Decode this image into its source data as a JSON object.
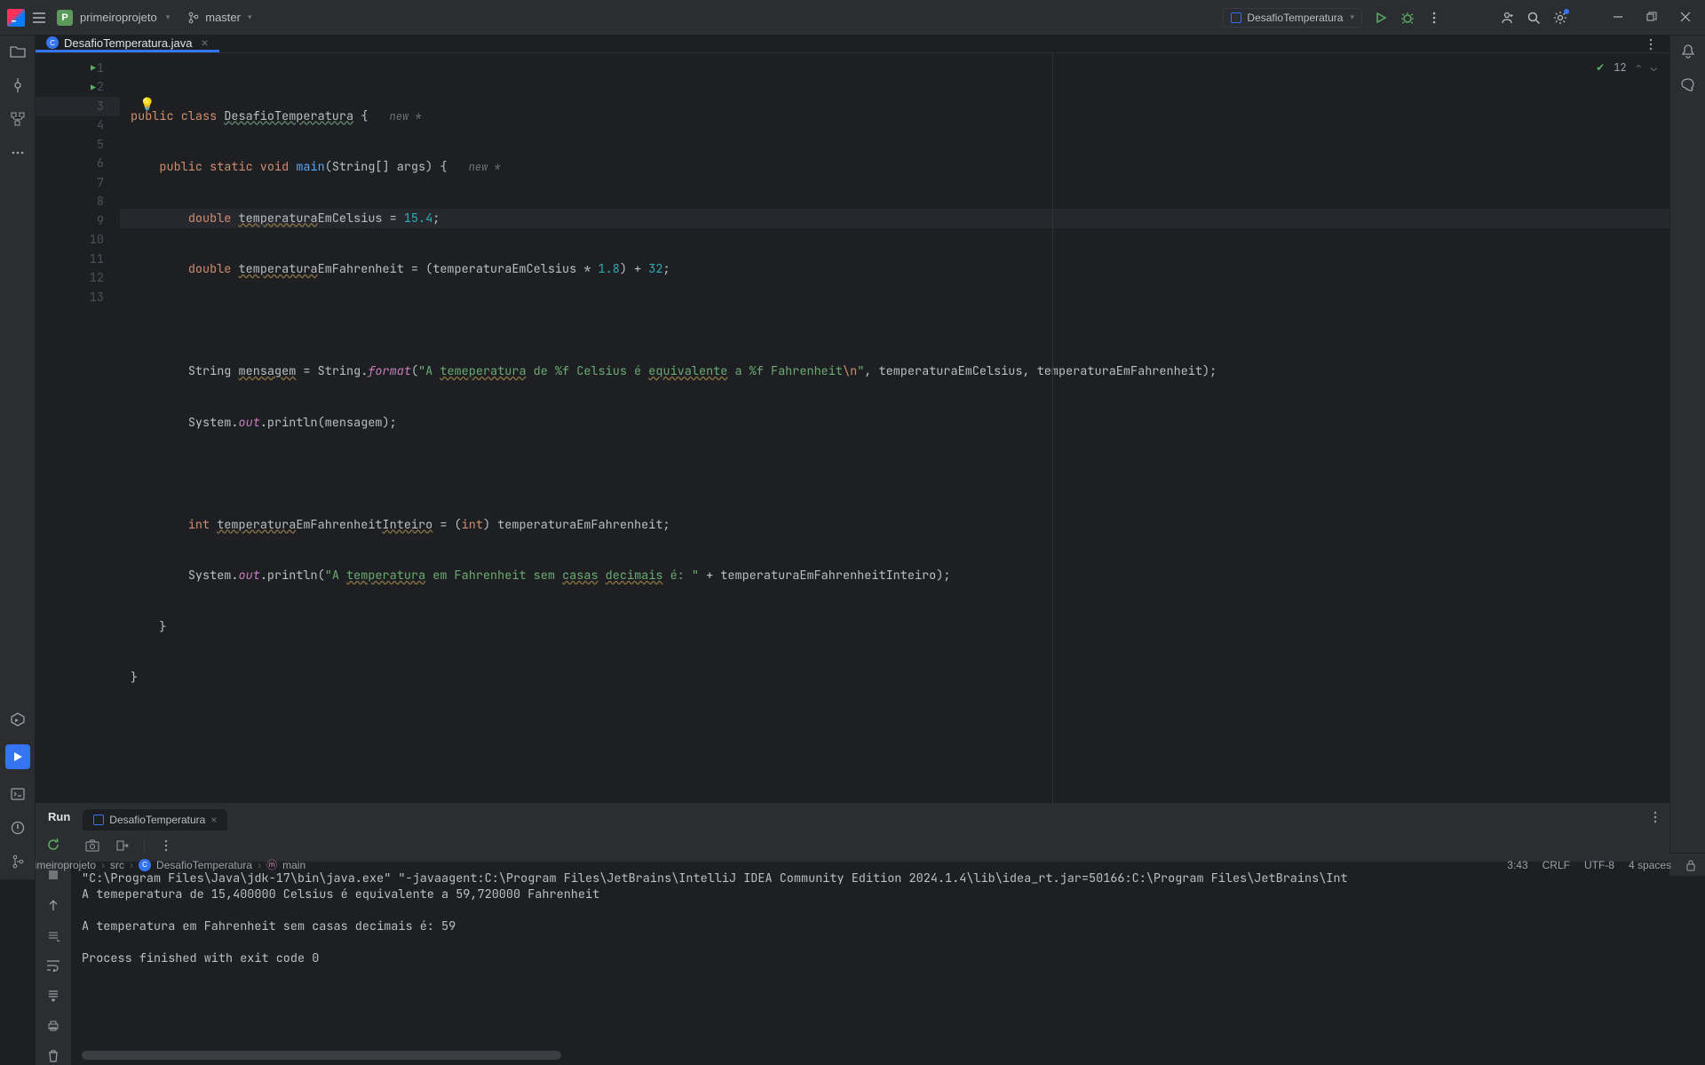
{
  "titlebar": {
    "project": "primeiroprojeto",
    "branch": "master",
    "runconfig": "DesafioTemperatura"
  },
  "tab": {
    "filename": "DesafioTemperatura.java"
  },
  "editor": {
    "problems": "12",
    "hint_new": "new *",
    "lines": [
      {
        "n": "1",
        "run": true
      },
      {
        "n": "2",
        "run": true
      },
      {
        "n": "3",
        "hl": true,
        "bulb": true
      },
      {
        "n": "4"
      },
      {
        "n": "5"
      },
      {
        "n": "6"
      },
      {
        "n": "7"
      },
      {
        "n": "8"
      },
      {
        "n": "9"
      },
      {
        "n": "10"
      },
      {
        "n": "11"
      },
      {
        "n": "12"
      },
      {
        "n": "13"
      }
    ],
    "code": {
      "l1": {
        "a": "public class ",
        "b": "DesafioTemperatura",
        "c": " {"
      },
      "l2": {
        "a": "public static void ",
        "b": "main",
        "c": "(String[] args) {"
      },
      "l3": {
        "a": "double ",
        "b": "temperatura",
        "c": "EmCelsius = ",
        "d": "15.4",
        "e": ";"
      },
      "l4": {
        "a": "double ",
        "b": "temperatura",
        "c": "EmFahrenheit = (temperaturaEmCelsius * ",
        "d": "1.8",
        "e": ") + ",
        "f": "32",
        "g": ";"
      },
      "l6": {
        "a": "String ",
        "b": "mensagem",
        "c": " = String.",
        "d": "format",
        "e": "(",
        "f": "\"A ",
        "g": "temeperatura",
        "h": " de %f Celsius é ",
        "i": "equivalente",
        "j": " a %f Fahrenheit",
        "k": "\\n",
        "l": "\"",
        "m": ", temperaturaEmCelsius, temperaturaEmFahrenheit);"
      },
      "l7": {
        "a": "System.",
        "b": "out",
        "c": ".println(mensagem);"
      },
      "l9": {
        "a": "int ",
        "b": "temperatura",
        "c": "EmFahrenheit",
        "d": "Inteiro",
        "e": " = (",
        "f": "int",
        "g": ") temperaturaEmFahrenheit;"
      },
      "l10": {
        "a": "System.",
        "b": "out",
        "c": ".println(",
        "d": "\"A ",
        "e": "temperatura",
        "f": " em Fahrenheit sem ",
        "g": "casas",
        "h": " ",
        "i": "decimais",
        "j": " é: \"",
        "k": " + temperaturaEmFahrenheitInteiro);"
      },
      "l11": "}",
      "l12": "}"
    }
  },
  "run": {
    "title": "Run",
    "tab": "DesafioTemperatura",
    "out_l1": "\"C:\\Program Files\\Java\\jdk-17\\bin\\java.exe\" \"-javaagent:C:\\Program Files\\JetBrains\\IntelliJ IDEA Community Edition 2024.1.4\\lib\\idea_rt.jar=50166:C:\\Program Files\\JetBrains\\Int",
    "out_l2": "A temeperatura de 15,400000 Celsius é equivalente a 59,720000 Fahrenheit",
    "out_l3": "",
    "out_l4": "A temperatura em Fahrenheit sem casas decimais é: 59",
    "out_l5": "",
    "out_l6": "Process finished with exit code 0"
  },
  "status": {
    "crumbs": [
      "primeiroprojeto",
      "src",
      "DesafioTemperatura",
      "main"
    ],
    "pos": "3:43",
    "eol": "CRLF",
    "enc": "UTF-8",
    "indent": "4 spaces"
  }
}
